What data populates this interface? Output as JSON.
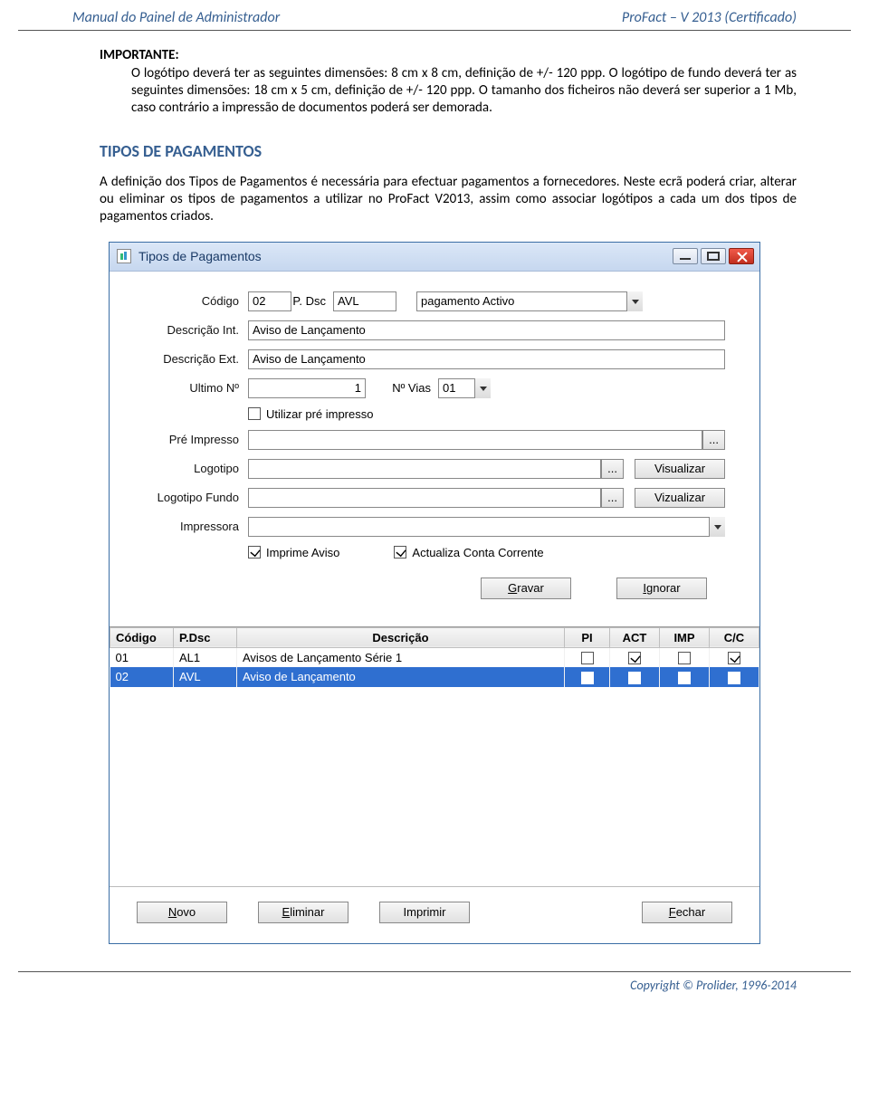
{
  "header": {
    "left": "Manual do Painel de Administrador",
    "right": "ProFact – V 2013 (Certificado)"
  },
  "important_label": "IMPORTANTE:",
  "important_text": "O logótipo deverá ter as seguintes dimensões: 8 cm x 8 cm, definição de +/- 120 ppp. O logótipo de fundo deverá ter as seguintes dimensões: 18 cm x 5 cm, definição de +/-  120 ppp. O tamanho dos ficheiros não deverá ser superior a 1 Mb, caso contrário a impressão de documentos poderá ser demorada.",
  "section_title": "TIPOS DE PAGAMENTOS",
  "section_text": "A definição dos Tipos de Pagamentos é necessária para efectuar pagamentos a fornecedores. Neste ecrã poderá criar, alterar ou eliminar os tipos de pagamentos a utilizar no ProFact V2013, assim como associar logótipos a cada um dos tipos de pagamentos criados.",
  "window": {
    "title": "Tipos de Pagamentos",
    "labels": {
      "codigo": "Código",
      "pdsc": "P. Dsc",
      "status_placeholder": "pagamento Activo",
      "desc_int": "Descrição Int.",
      "desc_ext": "Descrição Ext.",
      "ultimo_no": "Ultimo Nº",
      "no_vias": "Nº Vias",
      "utilizar_pre": "Utilizar pré impresso",
      "pre_impresso": "Pré Impresso",
      "logotipo": "Logotipo",
      "logotipo_fundo": "Logotipo Fundo",
      "impressora": "Impressora",
      "imprime_aviso": "Imprime Aviso",
      "actualiza_cc": "Actualiza Conta Corrente"
    },
    "values": {
      "codigo": "02",
      "pdsc": "AVL",
      "desc_int": "Aviso de Lançamento",
      "desc_ext": "Aviso de Lançamento",
      "ultimo_no": "1",
      "no_vias": "01",
      "imprime_aviso_checked": true,
      "actualiza_cc_checked": true,
      "utilizar_pre_checked": false
    },
    "buttons": {
      "browse": "...",
      "visualizar": "Visualizar",
      "vizualizar": "Vizualizar",
      "gravar": "Gravar",
      "gravar_accel": "G",
      "ignorar": "Ignorar",
      "ignorar_accel": "I",
      "novo": "Novo",
      "novo_accel": "N",
      "eliminar": "Eliminar",
      "eliminar_accel": "E",
      "imprimir": "Imprimir",
      "fechar": "Fechar",
      "fechar_accel": "F"
    },
    "grid": {
      "headers": {
        "codigo": "Código",
        "pdsc": "P.Dsc",
        "descricao": "Descrição",
        "pi": "PI",
        "act": "ACT",
        "imp": "IMP",
        "cc": "C/C"
      },
      "rows": [
        {
          "codigo": "01",
          "pdsc": "AL1",
          "descricao": "Avisos de Lançamento Série 1",
          "pi": false,
          "act": true,
          "imp": false,
          "cc": true,
          "selected": false
        },
        {
          "codigo": "02",
          "pdsc": "AVL",
          "descricao": "Aviso de Lançamento",
          "pi": false,
          "act": true,
          "imp": true,
          "cc": true,
          "selected": true
        }
      ]
    }
  },
  "footer": "Copyright © Prolider, 1996-2014"
}
